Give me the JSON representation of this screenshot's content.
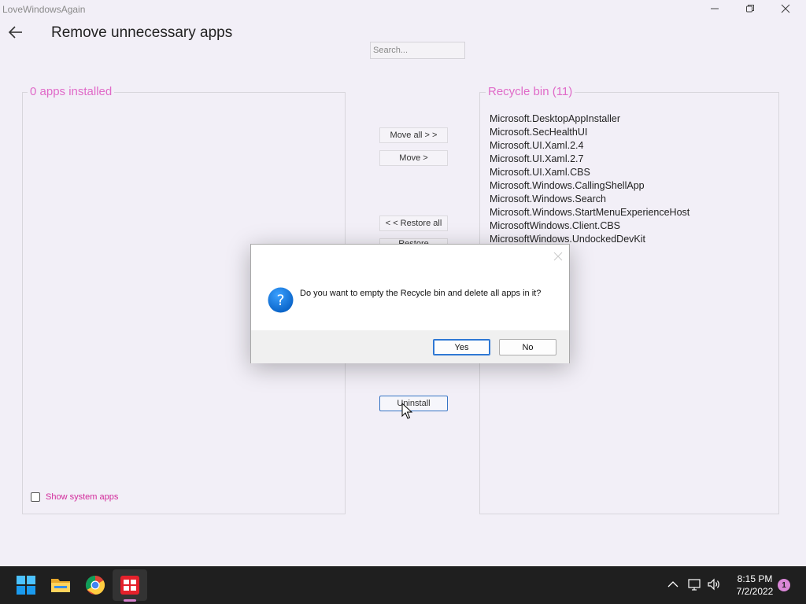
{
  "window": {
    "title": "LoveWindowsAgain"
  },
  "header": {
    "title": "Remove unnecessary apps"
  },
  "search": {
    "placeholder": "Search...",
    "value": ""
  },
  "left_panel": {
    "title": "0 apps installed",
    "items": [],
    "show_system_apps_label": "Show system apps",
    "show_system_apps_checked": false
  },
  "right_panel": {
    "title": "Recycle bin (11)",
    "items": [
      "Microsoft.DesktopAppInstaller",
      "Microsoft.SecHealthUI",
      "Microsoft.UI.Xaml.2.4",
      "Microsoft.UI.Xaml.2.7",
      "Microsoft.UI.Xaml.CBS",
      "Microsoft.Windows.CallingShellApp",
      "Microsoft.Windows.Search",
      "Microsoft.Windows.StartMenuExperienceHost",
      "MicrosoftWindows.Client.CBS",
      "MicrosoftWindows.UndockedDevKit"
    ]
  },
  "actions": {
    "move_all": "Move all > >",
    "move": "Move >",
    "restore_all": "< < Restore all",
    "restore": "Restore",
    "uninstall": "Uninstall"
  },
  "dialog": {
    "message": "Do you want to empty the Recycle bin and delete all apps in it?",
    "yes": "Yes",
    "no": "No",
    "icon": "question-icon"
  },
  "taskbar": {
    "pinned": [
      "start-icon",
      "file-explorer-icon",
      "chrome-icon",
      "app-icon"
    ],
    "tray": [
      "chevron-up-icon",
      "network-icon",
      "volume-icon"
    ],
    "time": "8:15 PM",
    "date": "7/2/2022",
    "notification_count": "1"
  },
  "colors": {
    "accent_pink": "#e06ac8",
    "link_pink": "#d22a9b",
    "dialog_button_blue": "#2f78d4",
    "background": "#f2eff7"
  }
}
